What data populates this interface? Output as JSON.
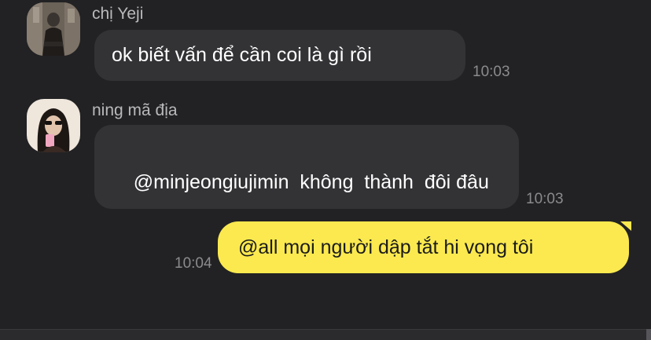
{
  "messages": [
    {
      "sender": "chị Yeji",
      "text": "ok biết vấn để cần coi là gì rồi",
      "time": "10:03",
      "avatar": "avatar-yeji"
    },
    {
      "sender": "ning mã địa",
      "text": "@minjeongiujimin  không  thành  đôi đâu",
      "time": "10:03",
      "avatar": "avatar-ning"
    },
    {
      "sender": "",
      "text": "@all mọi người dập tắt hi vọng tôi",
      "time": "10:04",
      "outgoing": true
    }
  ],
  "colors": {
    "background": "#222224",
    "incoming_bubble": "#333336",
    "outgoing_bubble": "#fbe94f",
    "timestamp": "#8b8b8e",
    "sender_name": "#b9b9bb"
  }
}
